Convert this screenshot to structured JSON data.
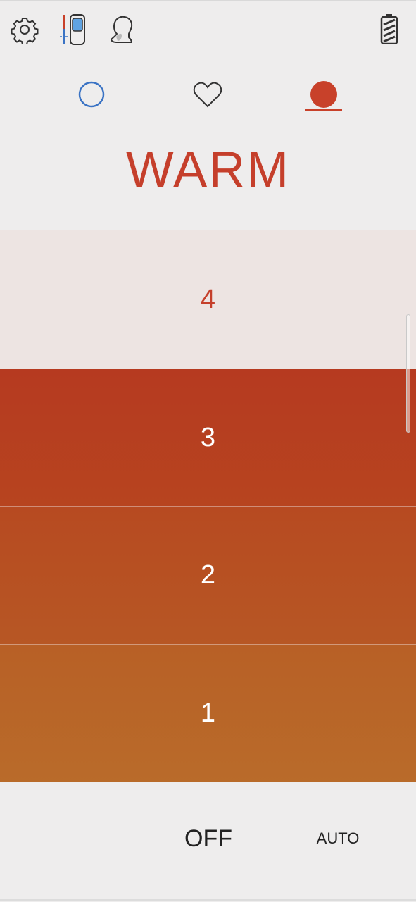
{
  "header": {
    "icons": [
      "gear-icon",
      "remote-thermometer-icon",
      "person-neck-icon",
      "battery-icon"
    ]
  },
  "modes": {
    "items": [
      {
        "name": "cool",
        "icon": "circle-outline-icon",
        "color": "#3a73c4"
      },
      {
        "name": "heart",
        "icon": "heart-outline-icon",
        "color": "#333333"
      },
      {
        "name": "warm",
        "icon": "filled-circle-icon",
        "color": "#c8412a",
        "selected": true
      }
    ]
  },
  "mode_title": "WARM",
  "levels": [
    {
      "label": "4",
      "selected": true
    },
    {
      "label": "3"
    },
    {
      "label": "2"
    },
    {
      "label": "1"
    }
  ],
  "footer": {
    "off_label": "OFF",
    "auto_label": "AUTO"
  },
  "colors": {
    "accent": "#c53f2b",
    "background": "#eeeded"
  }
}
